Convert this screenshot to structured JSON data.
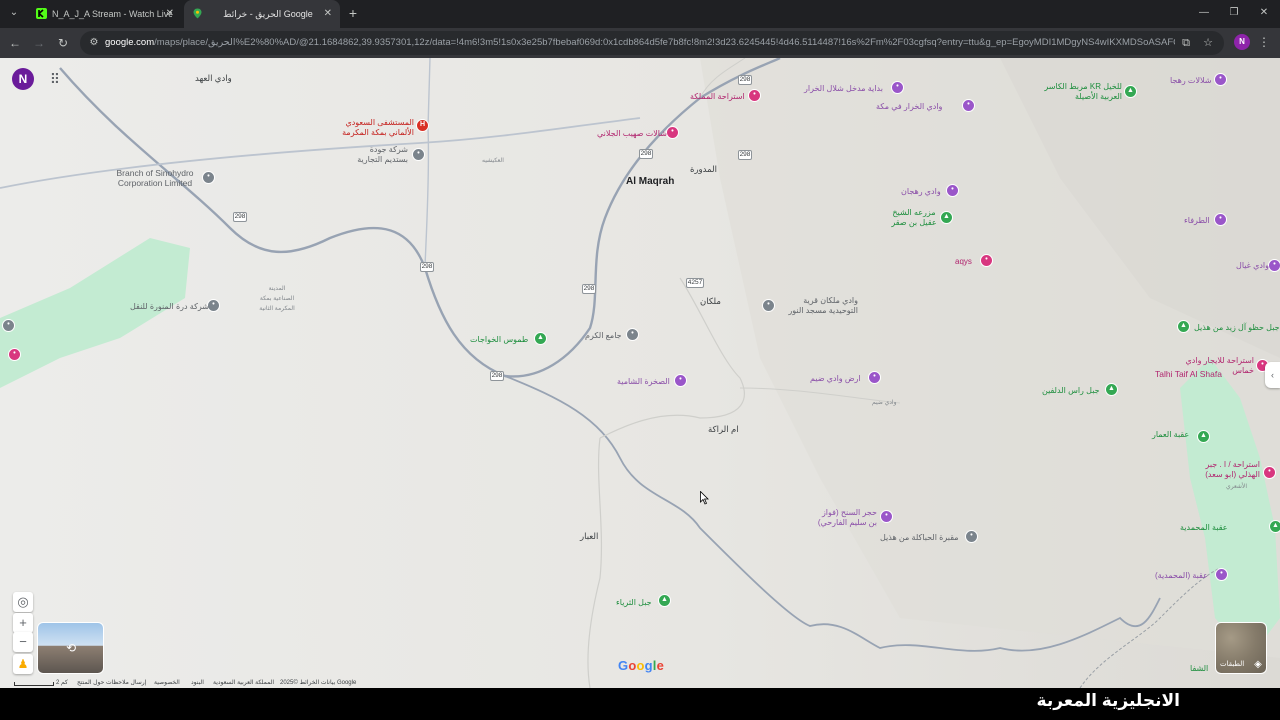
{
  "browser": {
    "tabs": [
      {
        "title": "N_A_J_A Stream - Watch Live on",
        "favicon": "kick-icon",
        "active": false
      },
      {
        "title": "الحريق - خرائط Google",
        "favicon": "google-maps-icon",
        "active": true
      }
    ],
    "tab_close": "✕",
    "new_tab": "+",
    "url_host": "google.com",
    "url_rest": "/maps/place/الحريق%E2%80%AD/@21.1684862,39.9357301,12z/data=!4m6!3m5!1s0x3e25b7fbebaf069d:0x1cdb864d5fe7b8fc!8m2!3d23.6245445!4d46.5114487!16s%2Fm%2F03cgfsq?entry=ttu&g_ep=EgoyMDI1MDgyNS4wIKXMDSoASAFQAw%3...",
    "profile_initial": "N"
  },
  "map": {
    "avatar_initial": "N",
    "labels": {
      "wadi_aleih": "وادي العهد",
      "hospital": "المستشفى السعودي الألماني بمكة المكرمة",
      "jouda": "شركة جودة بستديم التجارية",
      "sinohydro": "Branch of Sinohydro Corporation Limited",
      "akishiya": "العكيشيه",
      "industrial": "المدينة الصناعية بمكة المكرمة الثانية",
      "durrat": "شركة درة المنورة للنقل",
      "tawoos": "طموس الخواجات",
      "jamie_karam": "جامع الكرم",
      "sakhra": "الصخرة الشامية",
      "um_rakah": "ام الراكة",
      "abar": "العبار",
      "jabal_thurya": "جبل الثرياء",
      "istiraha_mamlaka": "استراحة المملكة",
      "suhaib": "شالات صهيب الجلاني",
      "maqrah_en": "Al Maqrah",
      "madwara": "المدورة",
      "malkan": "ملكان",
      "wadi_malkan": "وادي ملكان قرية التوحيدية مسجد النور",
      "shalal": "بداية مدخل شلال الخرار",
      "wadi_kharrar": "وادي الخرار في مكة",
      "wadi_rahjan": "وادي رهجان",
      "mazraa": "مزرعه الشيخ عقيل بن صقر",
      "aqys": "aqys",
      "ard_wadi": "ارض وادي ضيم",
      "wadi_dheem": "وادي ضيم",
      "hajr_sanih": "حجر السنح (فواز بن سليم الفارحي)",
      "maqbara": "مقبرة الحباكلة من هذيل",
      "kr_center": "مربط الكاسر KR للخيل العربية الأصيلة",
      "shalalat_rahja": "شلالات رهجا",
      "tarfaa": "الطرفاء",
      "wadi_ghayal": "وادي غيال",
      "jabal_zaid": "جبل حظو آل زيد من هذيل",
      "istiraha_khamas": "استراحة للايجار وادي خماس",
      "talhi": "Talhi Taif Al Shafa",
      "ras_dalfin": "جبل راس الدلفين",
      "aqabat_ammar": "عقبة العمار",
      "istiraha_jabr": "استراحة / ا . جبر الهذلي (ابو سعد)",
      "ashaari": "الأشعري",
      "aqabat_muhammadiya": "عقبة المحمدية",
      "aqabat_muhammadiya2": "عقبة (المحمدية)",
      "shafa": "الشفا"
    },
    "shields": {
      "r298": "298",
      "r4257": "4257"
    },
    "layers_label": "الطبقات",
    "google_logo": [
      "G",
      "o",
      "o",
      "g",
      "l",
      "e"
    ],
    "logo_colors": [
      "#4285f4",
      "#ea4335",
      "#fbbc05",
      "#4285f4",
      "#34a853",
      "#ea4335"
    ],
    "footer": {
      "scale": "2 كم",
      "feedback": "إرسال ملاحظات حول المنتج",
      "privacy": "الخصوصية",
      "terms": "البنود",
      "country": "المملكة العربية السعودية",
      "map_data": "بيانات الخرائط ©2025 Google"
    }
  },
  "caption": "الانجليزية المعربة",
  "colors": {
    "map_bg": "#ececea",
    "road": "#98a3b3",
    "green_area": "#b8e6c9",
    "poi_pink": "#d8367f",
    "poi_purple": "#9a56c9",
    "poi_green": "#34a853"
  }
}
